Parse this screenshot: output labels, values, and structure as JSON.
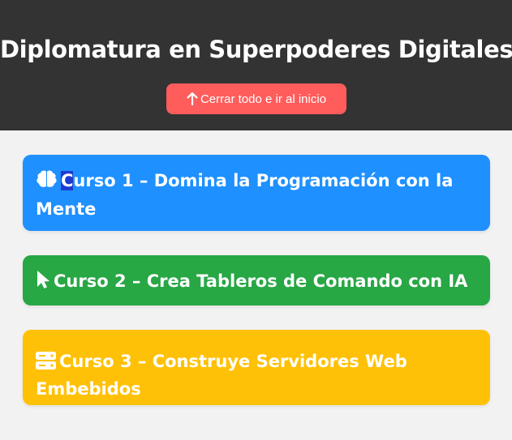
{
  "header": {
    "title": "Diplomatura en Superpoderes Digitales",
    "background": "#333333",
    "top_button": {
      "label": "Cerrar todo e ir al inicio",
      "icon": "arrow-up-icon",
      "color": "#ff5c5c"
    }
  },
  "courses": [
    {
      "icon": "brain-icon",
      "label_first": "C",
      "label_rest": "urso 1 – Domina la Programación con la Mente",
      "color": "#1e90ff"
    },
    {
      "icon": "pointer-icon",
      "label": "Curso 2 – Crea Tableros de Comando con IA",
      "color": "#28a745"
    },
    {
      "icon": "server-icon",
      "label": "Curso 3 – Construye Servidores Web Embebidos",
      "color": "#ffc107"
    }
  ],
  "page_background": "#f2f2f2"
}
